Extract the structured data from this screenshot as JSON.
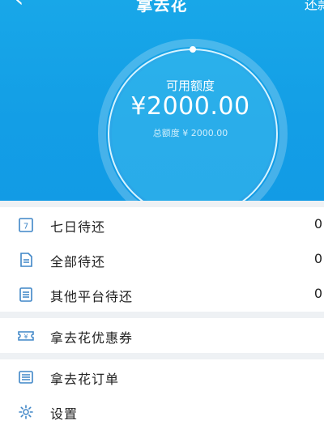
{
  "header": {
    "title": "拿去花",
    "right_action": "还款"
  },
  "credit": {
    "available_label": "可用额度",
    "available_amount": "¥2000.00",
    "total_label": "总额度 ¥ 2000.00",
    "available_ratio": 1.0
  },
  "menu": {
    "repay": [
      {
        "label": "七日待还",
        "value": "0",
        "icon": "calendar-7-icon"
      },
      {
        "label": "全部待还",
        "value": "0",
        "icon": "document-icon"
      },
      {
        "label": "其他平台待还",
        "value": "0",
        "icon": "list-icon"
      }
    ],
    "coupon": {
      "label": "拿去花优惠券",
      "icon": "coupon-icon"
    },
    "orders": {
      "label": "拿去花订单",
      "icon": "order-list-icon"
    },
    "settings": {
      "label": "设置",
      "icon": "gear-icon"
    }
  },
  "colors": {
    "brand": "#139ee6",
    "icon_blue": "#3f86c7"
  }
}
